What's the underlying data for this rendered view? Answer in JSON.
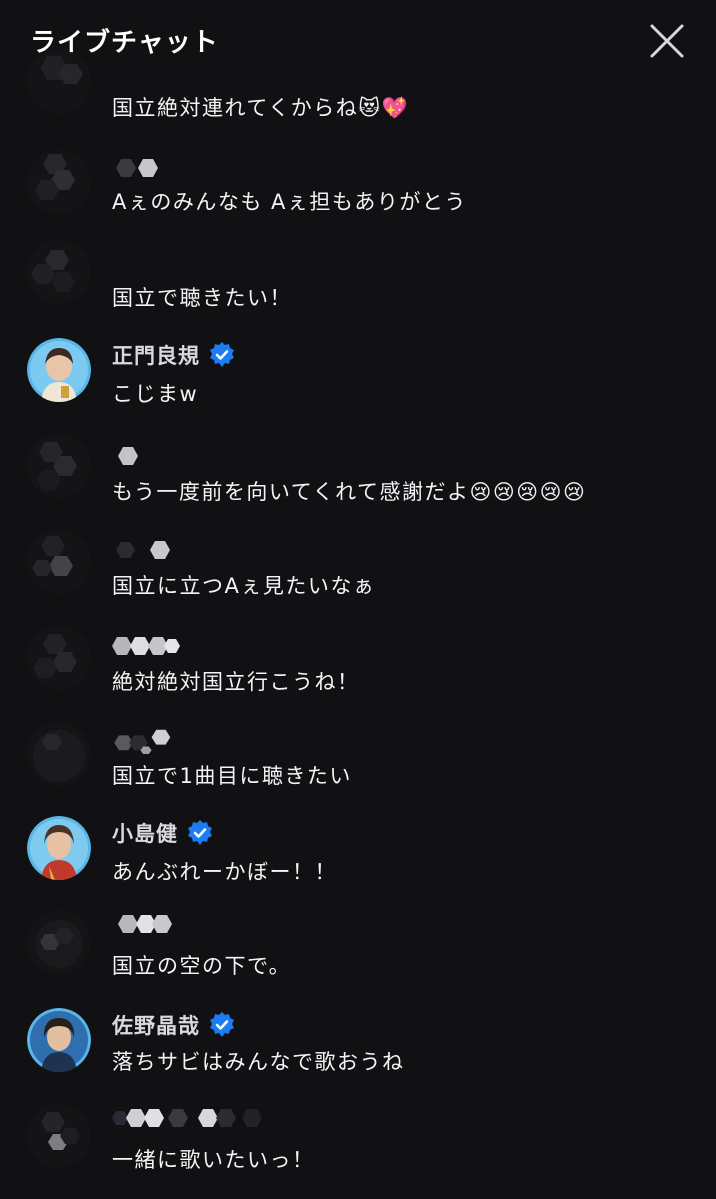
{
  "header": {
    "title": "ライブチャット",
    "close_icon": "close-icon"
  },
  "messages": [
    {
      "user": "",
      "verified": false,
      "text": "国立絶対連れてくからね😻💖"
    },
    {
      "user": "",
      "verified": false,
      "text": "Aぇのみんなも Aぇ担もありがとう"
    },
    {
      "user": "",
      "verified": false,
      "text": "国立で聴きたい！"
    },
    {
      "user": "正門良規",
      "verified": true,
      "text": "こじまw"
    },
    {
      "user": "",
      "verified": false,
      "text": "もう一度前を向いてくれて感謝だよ😢😢😢😢😢"
    },
    {
      "user": "",
      "verified": false,
      "text": "国立に立つAぇ見たいなぁ"
    },
    {
      "user": "",
      "verified": false,
      "text": "絶対絶対国立行こうね！"
    },
    {
      "user": "",
      "verified": false,
      "text": "国立で1曲目に聴きたい"
    },
    {
      "user": "小島健",
      "verified": true,
      "text": "あんぶれーかぼー！！"
    },
    {
      "user": "",
      "verified": false,
      "text": "国立の空の下で。"
    },
    {
      "user": "佐野晶哉",
      "verified": true,
      "text": "落ちサビはみんなで歌おうね"
    },
    {
      "user": "",
      "verified": false,
      "text": "一緒に歌いたいっ！"
    }
  ],
  "colors": {
    "background": "#111113",
    "verified_badge": "#1d7cf2",
    "text": "#f4f4f6",
    "username": "#d9d9de"
  }
}
